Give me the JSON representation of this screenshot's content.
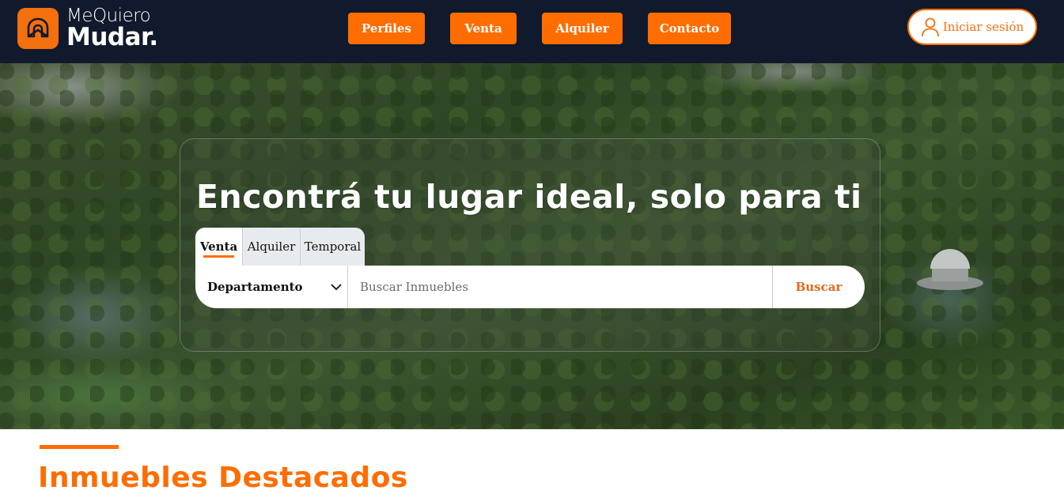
{
  "brand": {
    "line1": "MeQuiero",
    "line2": "Mudar.",
    "accent_color": "#ff6d00",
    "header_bg": "#111a2c"
  },
  "nav": {
    "items": [
      {
        "label": "Perfiles"
      },
      {
        "label": "Venta"
      },
      {
        "label": "Alquiler"
      },
      {
        "label": "Contacto"
      }
    ],
    "login_label": "Iniciar sesión",
    "login_icon": "user-icon"
  },
  "hero": {
    "title": "Encontrá tu lugar ideal, solo para ti",
    "tabs": [
      {
        "label": "Venta",
        "active": true
      },
      {
        "label": "Alquiler",
        "active": false
      },
      {
        "label": "Temporal",
        "active": false
      }
    ],
    "property_type": {
      "selected": "Departamento",
      "icon": "chevron-down-icon"
    },
    "search": {
      "placeholder": "Buscar Inmuebles",
      "value": ""
    },
    "search_button_label": "Buscar"
  },
  "featured": {
    "title": "Inmuebles Destacados"
  }
}
